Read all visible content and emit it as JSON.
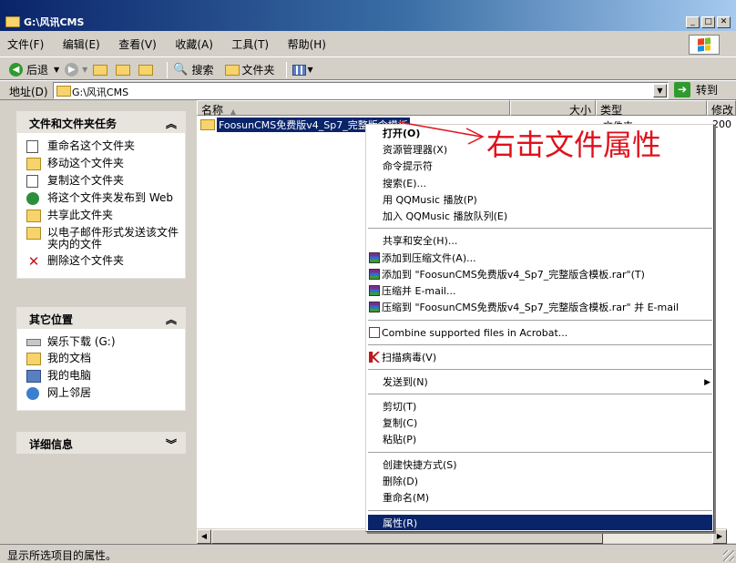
{
  "window": {
    "title": "G:\\风讯CMS",
    "controls": [
      "_",
      "□",
      "✕"
    ]
  },
  "menubar": {
    "items": [
      "文件(F)",
      "编辑(E)",
      "查看(V)",
      "收藏(A)",
      "工具(T)",
      "帮助(H)"
    ]
  },
  "toolbar": {
    "back": "后退",
    "search": "搜索",
    "folders": "文件夹"
  },
  "address": {
    "label": "地址(D)",
    "value": "G:\\风讯CMS",
    "go": "转到"
  },
  "taskpane": {
    "file_tasks": {
      "title": "文件和文件夹任务",
      "items": [
        "重命名这个文件夹",
        "移动这个文件夹",
        "复制这个文件夹",
        "将这个文件夹发布到 Web",
        "共享此文件夹",
        "以电子邮件形式发送该文件夹内的文件",
        "删除这个文件夹"
      ]
    },
    "other_places": {
      "title": "其它位置",
      "items": [
        "娱乐下载 (G:)",
        "我的文档",
        "我的电脑",
        "网上邻居"
      ]
    },
    "details": {
      "title": "详细信息"
    }
  },
  "filelist": {
    "columns": {
      "name": "名称",
      "size": "大小",
      "type": "类型",
      "modified": "修改"
    },
    "rows": [
      {
        "name": "FoosunCMS免费版v4_Sp7_完整版含模板",
        "type": "文件夹",
        "modified": "200"
      }
    ]
  },
  "context_menu": {
    "items": [
      "打开(O)",
      "资源管理器(X)",
      "命令提示符",
      "搜索(E)...",
      "用 QQMusic 播放(P)",
      "加入 QQMusic 播放队列(E)",
      "共享和安全(H)...",
      "添加到压缩文件(A)...",
      "添加到 \"FoosunCMS免费版v4_Sp7_完整版含模板.rar\"(T)",
      "压缩并 E-mail...",
      "压缩到 \"FoosunCMS免费版v4_Sp7_完整版含模板.rar\" 并 E-mail",
      "Combine supported files in Acrobat...",
      "扫描病毒(V)",
      "发送到(N)",
      "剪切(T)",
      "复制(C)",
      "粘贴(P)",
      "创建快捷方式(S)",
      "删除(D)",
      "重命名(M)",
      "属性(R)"
    ]
  },
  "annotation": "右击文件属性",
  "statusbar": {
    "text": "显示所选项目的属性。"
  },
  "colors": {
    "selection": "#0a246a",
    "annotation": "#e0101a",
    "face": "#d4d0c8"
  }
}
